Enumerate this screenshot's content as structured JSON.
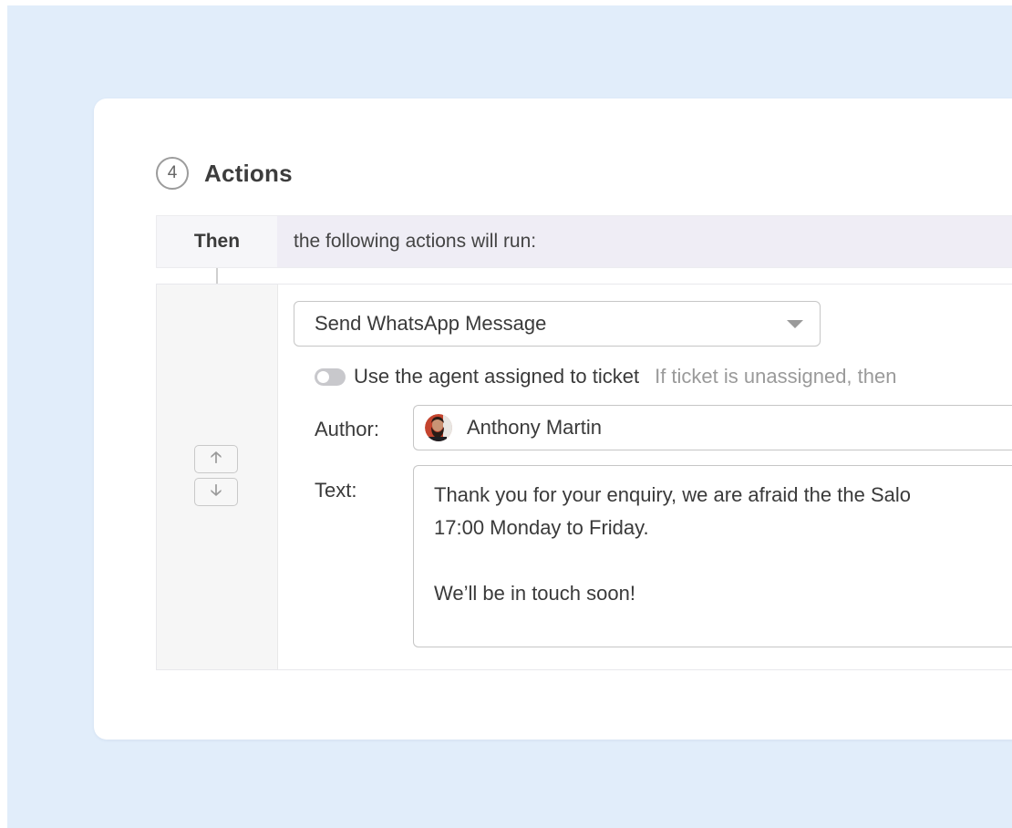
{
  "section": {
    "step_number": "4",
    "title": "Actions"
  },
  "then_row": {
    "label": "Then",
    "text": "the following actions will run:"
  },
  "action": {
    "type_select": {
      "value": "Send WhatsApp Message",
      "caret_icon": "chevron-down-icon"
    },
    "toggle": {
      "label": "Use the agent assigned to ticket",
      "hint": "If ticket is unassigned, then",
      "state": "off"
    },
    "author": {
      "label": "Author:",
      "name": "Anthony Martin"
    },
    "text": {
      "label": "Text:",
      "value": "Thank you for your enquiry, we are afraid the the Salo\n17:00 Monday to Friday.\n\nWe’ll be in touch soon!"
    },
    "reorder": {
      "up_icon": "arrow-up-icon",
      "down_icon": "arrow-down-icon"
    }
  },
  "colors": {
    "backdrop": "#e1edfa",
    "card": "#ffffff",
    "then_bar": "#efedf5",
    "border": "#c6c6c6"
  }
}
